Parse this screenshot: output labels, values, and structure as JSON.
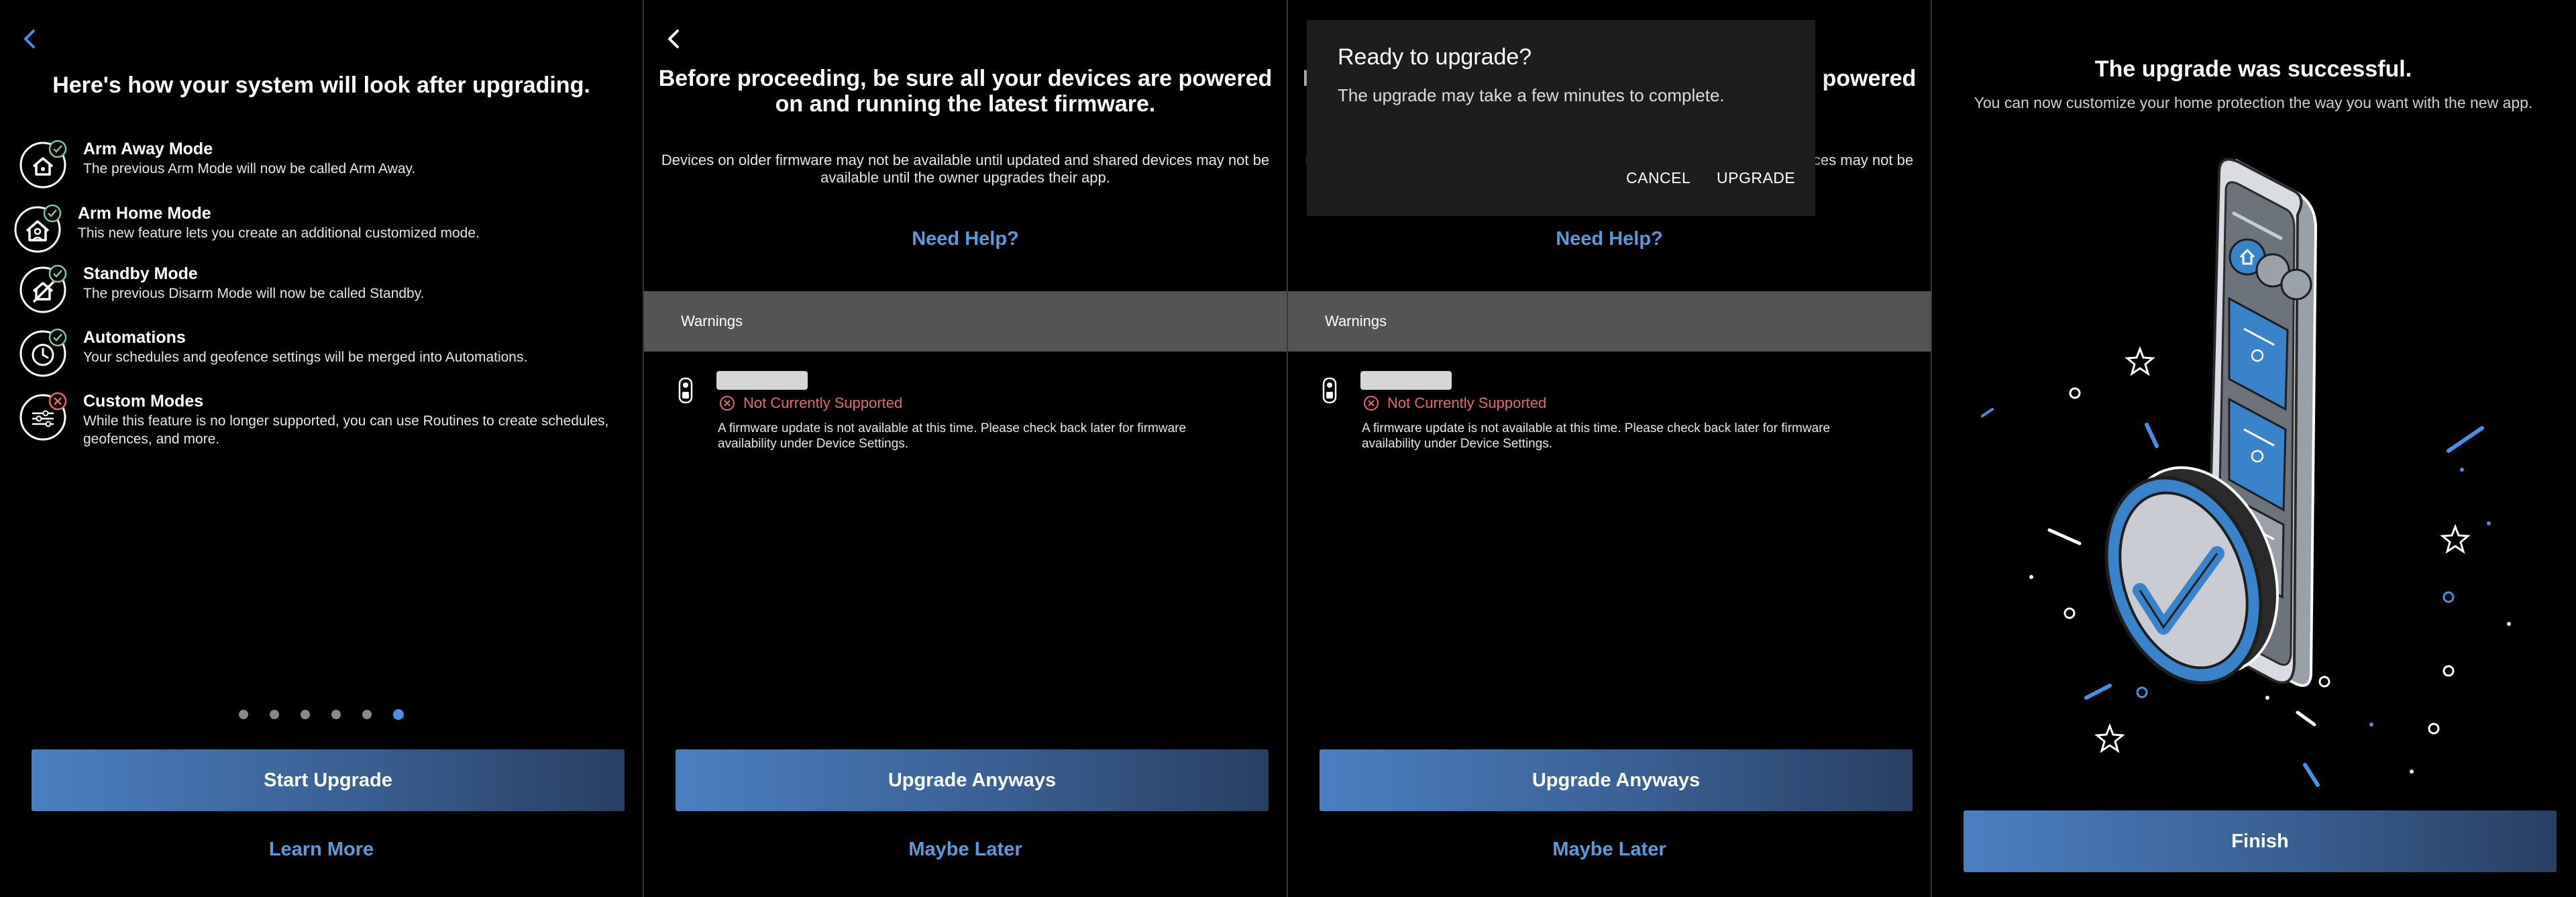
{
  "screen1": {
    "title": "Here's how your system will look after upgrading.",
    "features": [
      {
        "name": "Arm Away Mode",
        "desc": "The previous Arm Mode will now be called Arm Away.",
        "icon": "home-lock-icon",
        "badge": "check"
      },
      {
        "name": "Arm Home Mode",
        "desc": "This new feature lets you create an additional customized mode.",
        "icon": "home-person-icon",
        "badge": "check"
      },
      {
        "name": "Standby Mode",
        "desc": "The previous Disarm Mode will now be called Standby.",
        "icon": "shield-off-icon",
        "badge": "check"
      },
      {
        "name": "Automations",
        "desc": "Your schedules and geofence settings will be merged into Automations.",
        "icon": "clock-icon",
        "badge": "check"
      },
      {
        "name": "Custom Modes",
        "desc": "While this feature is no longer supported, you can use Routines to create schedules, geofences, and more.",
        "icon": "sliders-icon",
        "badge": "cross"
      }
    ],
    "page_indicator": {
      "total": 6,
      "current": 6
    },
    "primary_button": "Start Upgrade",
    "secondary_link": "Learn More"
  },
  "screen2": {
    "title": "Before proceeding, be sure all your devices are powered on and running the latest firmware.",
    "subtitle": "Devices on older firmware may not be available until updated and shared devices may not be available until the owner upgrades their app.",
    "help_link": "Need Help?",
    "warnings_label": "Warnings",
    "device": {
      "status": "Not Currently Supported",
      "message": "A firmware update is not available at this time. Please check back later for firmware availability under Device Settings."
    },
    "primary_button": "Upgrade Anyways",
    "secondary_link": "Maybe Later"
  },
  "screen3": {
    "help_link": "Need Help?",
    "warnings_label": "Warnings",
    "device": {
      "status": "Not Currently Supported",
      "message": "A firmware update is not available at this time. Please check back later for firmware availability under Device Settings."
    },
    "primary_button": "Upgrade Anyways",
    "secondary_link": "Maybe Later",
    "dialog": {
      "title": "Ready to upgrade?",
      "body": "The upgrade may take a few minutes to complete.",
      "cancel": "CANCEL",
      "confirm": "UPGRADE"
    }
  },
  "screen4": {
    "title": "The upgrade was successful.",
    "subtitle": "You can now customize your home protection the way you want with the new app.",
    "primary_button": "Finish"
  },
  "colors": {
    "accent": "#5a9bdc",
    "error": "#e36a6a",
    "success_badge": "#7fc89a",
    "warnings_bar": "#545454",
    "dialog_bg": "#1d1d1d"
  }
}
